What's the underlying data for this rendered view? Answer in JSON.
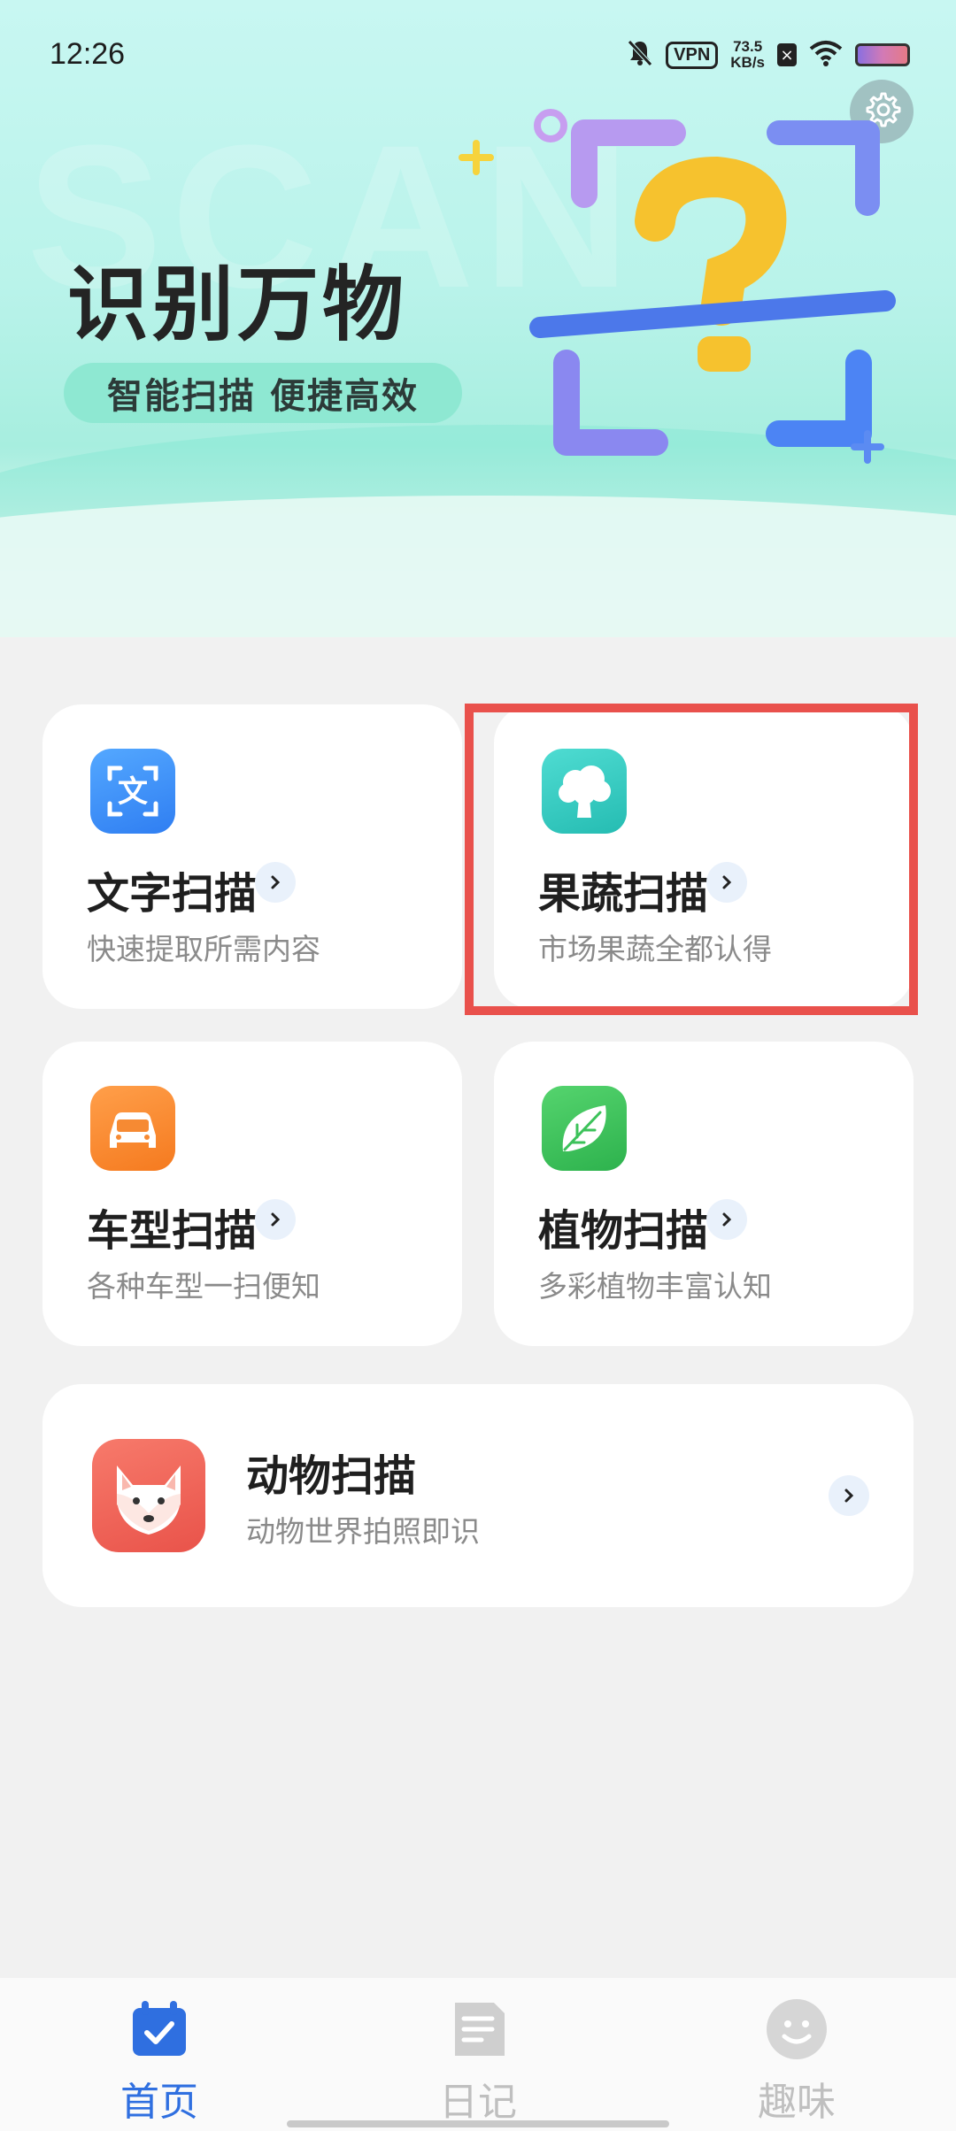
{
  "status_bar": {
    "time": "12:26",
    "vpn": "VPN",
    "speed_value": "73.5",
    "speed_unit": "KB/s"
  },
  "header": {
    "watermark": "SCAN",
    "title": "识别万物",
    "subtitle": "智能扫描 便捷高效",
    "settings_icon": "gear-icon"
  },
  "cards": [
    {
      "id": "text",
      "title": "文字扫描",
      "subtitle": "快速提取所需内容",
      "icon": "text-scan-icon",
      "icon_glyph": "文",
      "color": "#3f8df7"
    },
    {
      "id": "fruit",
      "title": "果蔬扫描",
      "subtitle": "市场果蔬全都认得",
      "icon": "broccoli-icon",
      "color": "#36cfc5"
    },
    {
      "id": "car",
      "title": "车型扫描",
      "subtitle": "各种车型一扫便知",
      "icon": "car-icon",
      "color": "#f98a34"
    },
    {
      "id": "plant",
      "title": "植物扫描",
      "subtitle": "多彩植物丰富认知",
      "icon": "leaf-icon",
      "color": "#3cc25a"
    },
    {
      "id": "animal",
      "title": "动物扫描",
      "subtitle": "动物世界拍照即识",
      "icon": "fox-icon",
      "color": "#f1665a"
    }
  ],
  "bottom_nav": {
    "items": [
      {
        "label": "首页",
        "icon": "calendar-check-icon",
        "active": true
      },
      {
        "label": "日记",
        "icon": "document-icon",
        "active": false
      },
      {
        "label": "趣味",
        "icon": "smiley-icon",
        "active": false
      }
    ],
    "active_color": "#2f6fe0",
    "inactive_color": "#bfbfbf"
  }
}
